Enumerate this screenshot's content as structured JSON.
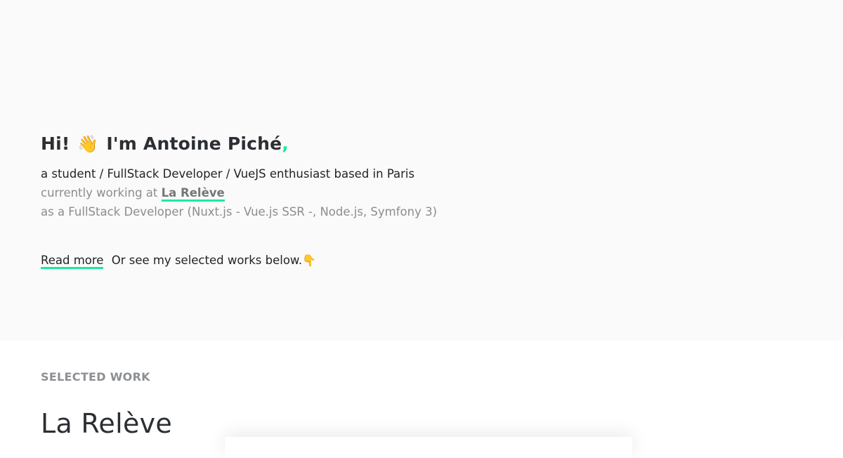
{
  "hero": {
    "greeting_prefix": "Hi!",
    "wave_emoji": "👋",
    "name_text": "I'm Antoine Piché",
    "comma": ",",
    "intro_line1": "a student / FullStack Developer / VueJS enthusiast based in Paris",
    "intro_line2_prefix": "currently working at ",
    "company_link": "La Relève",
    "intro_line3": "as a FullStack Developer (Nuxt.js - Vue.js SSR -, Node.js, Symfony 3)",
    "read_more_label": "Read more",
    "cta_text": "Or see my selected works below.",
    "pointer_emoji": "👇"
  },
  "work": {
    "section_label": "SELECTED WORK",
    "title": "La Relève"
  },
  "colors": {
    "accent": "#1de9a0",
    "hero_background": "#fafafa",
    "muted_text": "#8a8d91"
  }
}
